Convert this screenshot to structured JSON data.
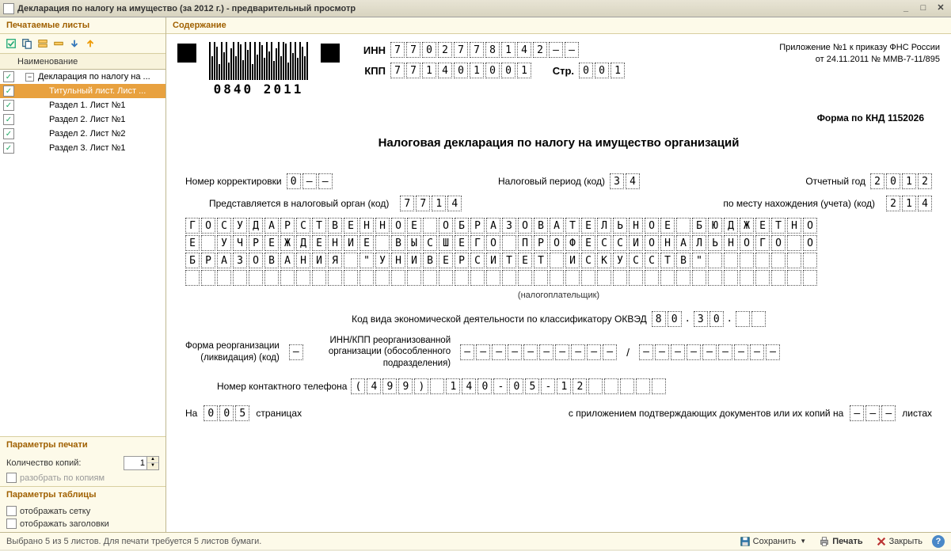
{
  "window": {
    "title": "Декларация по налогу на имущество (за 2012 г.) - предварительный просмотр"
  },
  "sidebar": {
    "header": "Печатаемые листы",
    "col": "Наименование",
    "items": [
      {
        "label": "Декларация по налогу на ...",
        "indent": 0,
        "checked": true,
        "expandable": true,
        "selected": false
      },
      {
        "label": "Титульный лист. Лист ...",
        "indent": 1,
        "checked": true,
        "selected": true
      },
      {
        "label": "Раздел 1. Лист №1",
        "indent": 1,
        "checked": true,
        "selected": false
      },
      {
        "label": "Раздел 2. Лист №1",
        "indent": 1,
        "checked": true,
        "selected": false
      },
      {
        "label": "Раздел 2. Лист №2",
        "indent": 1,
        "checked": true,
        "selected": false
      },
      {
        "label": "Раздел 3. Лист №1",
        "indent": 1,
        "checked": true,
        "selected": false
      }
    ],
    "print_params": {
      "header": "Параметры печати",
      "copies_label": "Количество копий:",
      "copies_value": "1",
      "split_label": "разобрать по копиям"
    },
    "table_params": {
      "header": "Параметры таблицы",
      "grid_label": "отображать сетку",
      "headers_label": "отображать заголовки"
    }
  },
  "content_header": "Содержание",
  "doc": {
    "barcode_text": "0840 2011",
    "inn_label": "ИНН",
    "inn": [
      "7",
      "7",
      "0",
      "2",
      "7",
      "7",
      "8",
      "1",
      "4",
      "2",
      "–",
      "–"
    ],
    "kpp_label": "КПП",
    "kpp": [
      "7",
      "7",
      "1",
      "4",
      "0",
      "1",
      "0",
      "0",
      "1"
    ],
    "page_label": "Стр.",
    "page": [
      "0",
      "0",
      "1"
    ],
    "appendix_l1": "Приложение №1 к приказу ФНС России",
    "appendix_l2": "от 24.11.2011 № ММВ-7-11/895",
    "form_code": "Форма по КНД 1152026",
    "title": "Налоговая декларация по налогу на имущество организаций",
    "corr_label": "Номер корректировки",
    "corr": [
      "0",
      "–",
      "–"
    ],
    "period_label": "Налоговый период  (код)",
    "period": [
      "3",
      "4"
    ],
    "year_label": "Отчетный год",
    "year": [
      "2",
      "0",
      "1",
      "2"
    ],
    "organ_label": "Представляется в налоговый орган  (код)",
    "organ": [
      "7",
      "7",
      "1",
      "4"
    ],
    "place_label": "по месту нахождения (учета)  (код)",
    "place": [
      "2",
      "1",
      "4"
    ],
    "taxpayer_rows": [
      "ГОСУДАРСТВЕННОЕ ОБРАЗОВАТЕЛЬНОЕ БЮДЖЕТНО",
      "Е УЧРЕЖДЕНИЕ ВЫСШЕГО ПРОФЕССИОНАЛЬНОГО О",
      "БРАЗОВАНИЯ \"УНИВЕРСИТЕТ ИСКУССТВ\"       ",
      "                                        "
    ],
    "taxpayer_cols": 40,
    "taxpayer_hint": "(налогоплательщик)",
    "okved_label": "Код вида экономической деятельности по классификатору ОКВЭД",
    "okved": [
      [
        "8",
        "0"
      ],
      [
        "3",
        "0"
      ],
      [
        "",
        ""
      ]
    ],
    "reorg_label_l1": "Форма реорганизации",
    "reorg_label_l2": "(ликвидация) (код)",
    "reorg_code": [
      "–"
    ],
    "reorg_inn_label_l1": "ИНН/КПП реорганизованной",
    "reorg_inn_label_l2": "организации (обособленного",
    "reorg_inn_label_l3": "подразделения)",
    "reorg_inn": [
      "–",
      "–",
      "–",
      "–",
      "–",
      "–",
      "–",
      "–",
      "–",
      "–"
    ],
    "reorg_kpp": [
      "–",
      "–",
      "–",
      "–",
      "–",
      "–",
      "–",
      "–",
      "–"
    ],
    "phone_label": "Номер контактного телефона",
    "phone": [
      "(",
      "4",
      "9",
      "9",
      ")",
      "",
      "1",
      "4",
      "0",
      "-",
      "0",
      "5",
      "-",
      "1",
      "2",
      "",
      "",
      "",
      "",
      ""
    ],
    "pages_prefix": "На",
    "pages": [
      "0",
      "0",
      "5"
    ],
    "pages_suffix": "страницах",
    "attach_label": "с приложением подтверждающих документов или их копий на",
    "attach": [
      "–",
      "–",
      "–"
    ],
    "attach_suffix": "листах"
  },
  "statusbar": {
    "text": "Выбрано 5 из 5 листов. Для печати требуется 5 листов бумаги.",
    "save": "Сохранить",
    "print": "Печать",
    "close": "Закрыть"
  }
}
